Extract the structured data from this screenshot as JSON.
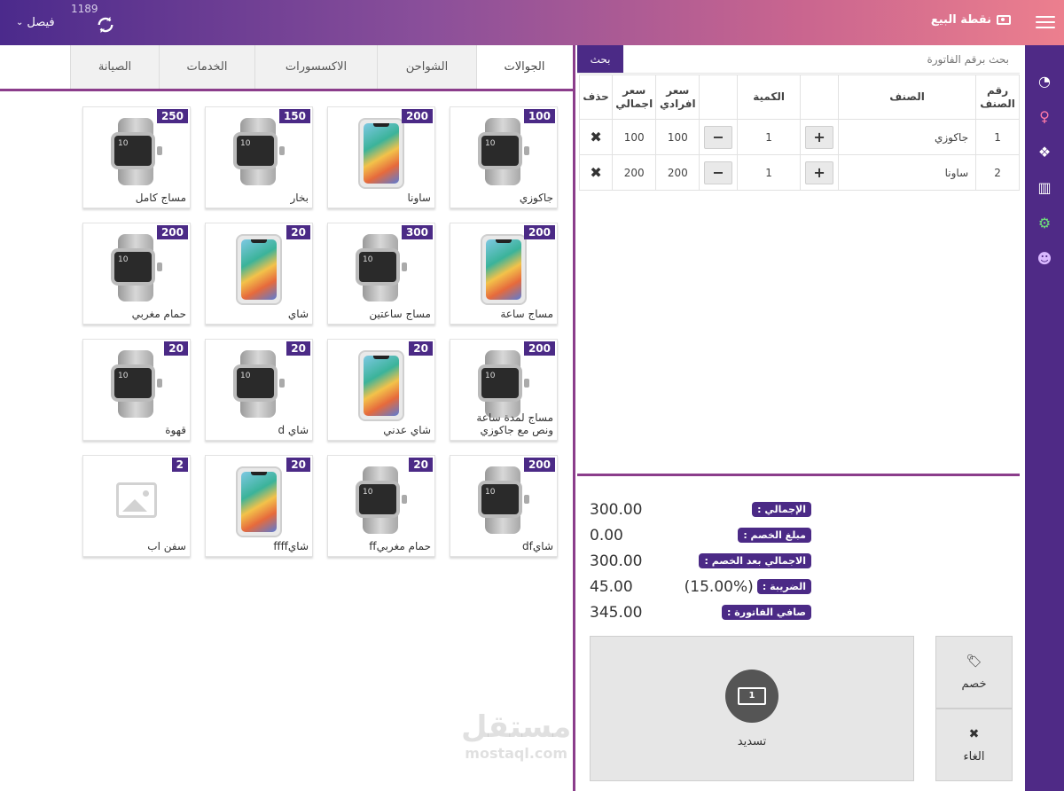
{
  "header": {
    "title": "نقطة البيع",
    "user": "فيصل",
    "counter": "1189"
  },
  "colors": {
    "accent": "#4b2a86",
    "divider": "#8b3d8b"
  },
  "sidebar": {
    "icons": [
      {
        "name": "dashboard-icon",
        "glyph": "◔",
        "color": "#ffffff"
      },
      {
        "name": "person-icon",
        "glyph": "♀",
        "color": "#ff7aa8"
      },
      {
        "name": "boxes-icon",
        "glyph": "❖",
        "color": "#ffffff"
      },
      {
        "name": "bar-chart-icon",
        "glyph": "▥",
        "color": "#ffffff"
      },
      {
        "name": "gears-icon",
        "glyph": "⚙",
        "color": "#6ee07a"
      },
      {
        "name": "users-icon",
        "glyph": "☻",
        "color": "#d9b8ff"
      }
    ]
  },
  "tabs": [
    {
      "label": "الجوالات",
      "active": true
    },
    {
      "label": "الشواحن",
      "active": false
    },
    {
      "label": "الاكسسورات",
      "active": false
    },
    {
      "label": "الخدمات",
      "active": false
    },
    {
      "label": "الصيانة",
      "active": false
    }
  ],
  "products": [
    {
      "name": "جاكوزي",
      "price": "100",
      "img": "watch"
    },
    {
      "name": "ساونا",
      "price": "200",
      "img": "phone"
    },
    {
      "name": "بخار",
      "price": "150",
      "img": "watch"
    },
    {
      "name": "مساج كامل",
      "price": "250",
      "img": "watch"
    },
    {
      "name": "مساج ساعة",
      "price": "200",
      "img": "phone"
    },
    {
      "name": "مساج ساعتين",
      "price": "300",
      "img": "watch"
    },
    {
      "name": "شاي",
      "price": "20",
      "img": "phone"
    },
    {
      "name": "حمام مغربي",
      "price": "200",
      "img": "watch"
    },
    {
      "name": "مساج لمدة ساعة ونص مع جاكوزي",
      "price": "200",
      "img": "watch"
    },
    {
      "name": "شاي عدني",
      "price": "20",
      "img": "phone"
    },
    {
      "name": "شاي d",
      "price": "20",
      "img": "watch"
    },
    {
      "name": "قهوة",
      "price": "20",
      "img": "watch"
    },
    {
      "name": "شايdf",
      "price": "200",
      "img": "watch"
    },
    {
      "name": "حمام مغربيff",
      "price": "20",
      "img": "watch"
    },
    {
      "name": "شايffff",
      "price": "20",
      "img": "phone"
    },
    {
      "name": "سفن اب",
      "price": "2",
      "img": "placeholder"
    }
  ],
  "search": {
    "placeholder": "بحث برقم الفاتورة",
    "button": "بحث"
  },
  "invoice": {
    "headers": [
      "رقم الصنف",
      "الصنف",
      "",
      "الكمية",
      "",
      "سعر افرادي",
      "سعر اجمالي",
      "حذف"
    ],
    "rows": [
      {
        "no": "1",
        "item": "جاكوزي",
        "qty": "1",
        "unit": "100",
        "total": "100"
      },
      {
        "no": "2",
        "item": "ساونا",
        "qty": "1",
        "unit": "200",
        "total": "200"
      }
    ]
  },
  "totals": [
    {
      "label": "الإجمالي :",
      "value": "300.00"
    },
    {
      "label": "مبلغ الخصم :",
      "value": "0.00"
    },
    {
      "label": "الاجمالي بعد الخصم :",
      "value": "300.00"
    },
    {
      "label": "الضريبة :",
      "value": "45.00",
      "extra": "(15.00%)"
    },
    {
      "label": "صافي الفاتورة :",
      "value": "345.00"
    }
  ],
  "actions": {
    "pay": "تسديد",
    "discount": "خصم",
    "cancel": "الغاء"
  },
  "watermark": {
    "ar": "مستقل",
    "en": "mostaql.com"
  }
}
